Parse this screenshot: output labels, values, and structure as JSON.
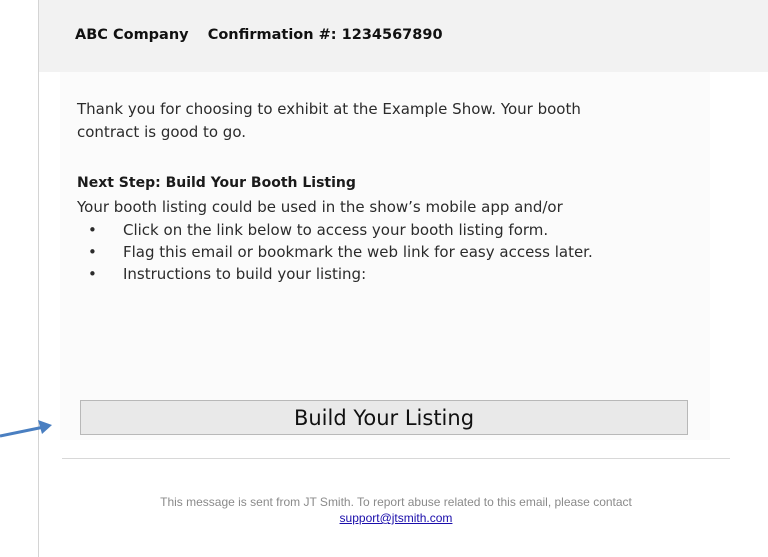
{
  "header": {
    "company": "ABC Company",
    "confirmation": "Confirmation #:  1234567890"
  },
  "intro": {
    "line1": "Thank you for choosing to exhibit at the Example Show. Your booth",
    "line2": "contract is good to go."
  },
  "next_step": {
    "title": "Next Step:  Build Your Booth Listing",
    "description": "Your booth listing could be used in the show’s mobile app and/or",
    "bullets": [
      "Click on the link below to access your booth listing form.",
      "Flag this email or bookmark the web link for easy access later.",
      "Instructions to build your listing:"
    ],
    "bullet_glyph": "•"
  },
  "cta": {
    "label": "Build Your Listing"
  },
  "footer": {
    "text": "This message is sent from JT Smith. To report abuse related to this email, please contact",
    "link": "support@jtsmith.com",
    "link_color": "#1a0dab"
  },
  "annotation": {
    "arrow_color": "#4a7fc1"
  }
}
